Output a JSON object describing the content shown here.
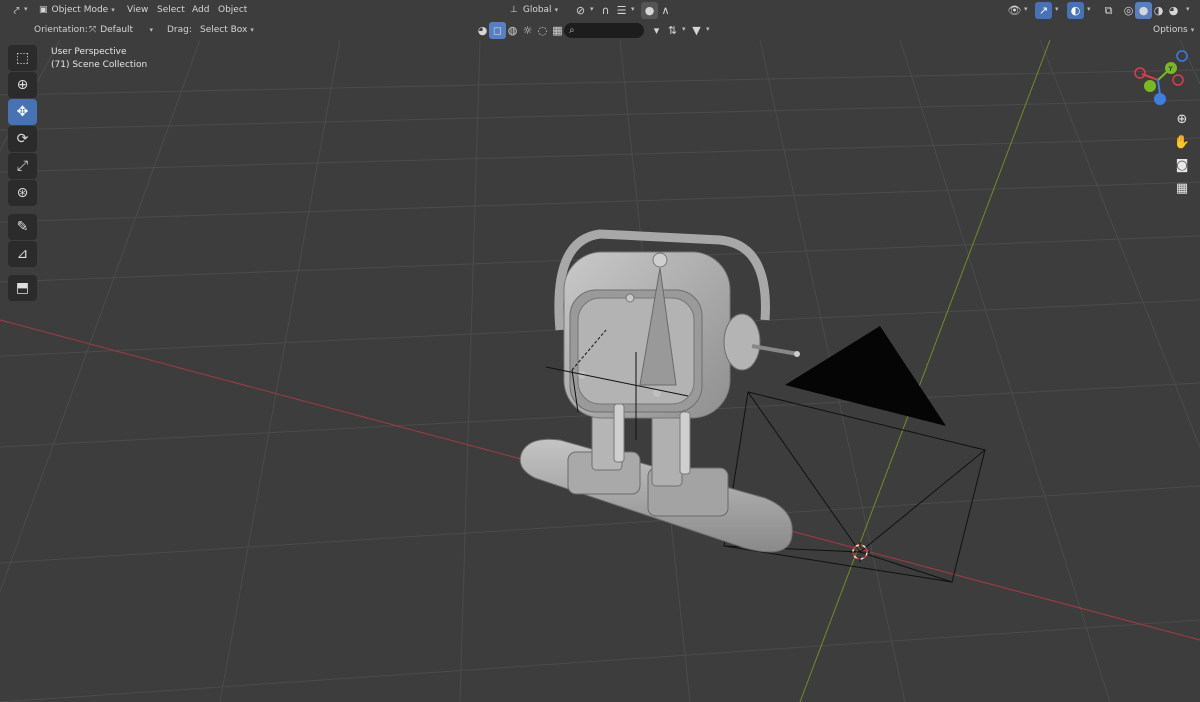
{
  "header": {
    "mode": "Object Mode",
    "menus": [
      "View",
      "Select",
      "Add",
      "Object"
    ],
    "transform_orientation": "Global",
    "editor_type_icon": "axis-icon"
  },
  "tool_settings": {
    "orientation_label": "Orientation:",
    "orientation_value": "Default",
    "drag_label": "Drag:",
    "drag_value": "Select Box",
    "options_label": "Options",
    "search_placeholder": ""
  },
  "overlay": {
    "perspective": "User Perspective",
    "collection": "(71) Scene Collection"
  },
  "toolbar": {
    "tools": [
      {
        "name": "select-box-tool",
        "icon": "cursor-icon",
        "active": false
      },
      {
        "name": "cursor-tool",
        "icon": "crosshair-icon",
        "active": false
      },
      {
        "name": "move-tool",
        "icon": "move-icon",
        "active": true
      },
      {
        "name": "rotate-tool",
        "icon": "rotate-icon",
        "active": false
      },
      {
        "name": "scale-tool",
        "icon": "scale-icon",
        "active": false
      },
      {
        "name": "transform-tool",
        "icon": "transform-icon",
        "active": false
      },
      {
        "name": "annotate-tool",
        "icon": "pencil-icon",
        "active": false
      },
      {
        "name": "measure-tool",
        "icon": "ruler-icon",
        "active": false
      },
      {
        "name": "add-cube-tool",
        "icon": "cube-icon",
        "active": false
      }
    ]
  },
  "colors": {
    "viewport_bg": "#3d3d3d",
    "grid_line": "#4a4a4a",
    "x_axis": "#a33a44",
    "y_axis": "#6f8c2a",
    "active_tool": "#4772b3",
    "gizmo_x": "#e03a4d",
    "gizmo_y": "#7ab821",
    "gizmo_z": "#3d7ee0"
  }
}
